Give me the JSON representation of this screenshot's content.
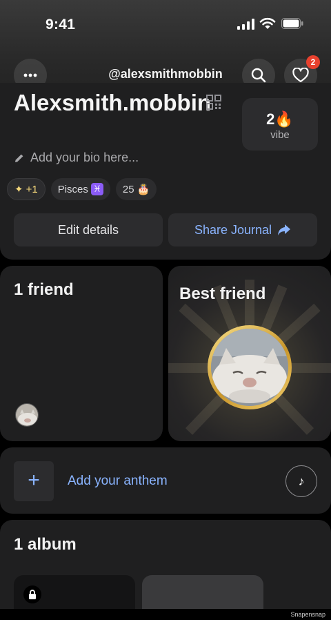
{
  "status_bar": {
    "time": "9:41"
  },
  "header": {
    "handle": "@alexsmithmobbin",
    "notification_count": "2"
  },
  "profile": {
    "name": "Alexsmith.mobbin",
    "vibe_count": "2",
    "vibe_emoji": "🔥",
    "vibe_label": "vibe",
    "bio_placeholder": "Add your bio here...",
    "chips": {
      "plus": "+1",
      "plus_glyph": "✦",
      "zodiac": "Pisces",
      "zodiac_glyph": "♓",
      "age": "25",
      "age_emoji": "🎂"
    },
    "edit_label": "Edit details",
    "share_label": "Share Journal"
  },
  "friends": {
    "title": "1 friend"
  },
  "best_friend": {
    "title": "Best friend"
  },
  "anthem": {
    "label": "Add your anthem",
    "plus_glyph": "+",
    "note_glyph": "♪"
  },
  "album": {
    "title": "1 album"
  },
  "watermark": "Snapensnap",
  "colors": {
    "accent": "#8ab4ff",
    "badge": "#e8412e",
    "gold": "#d9a93a",
    "card": "#1f1f20"
  }
}
